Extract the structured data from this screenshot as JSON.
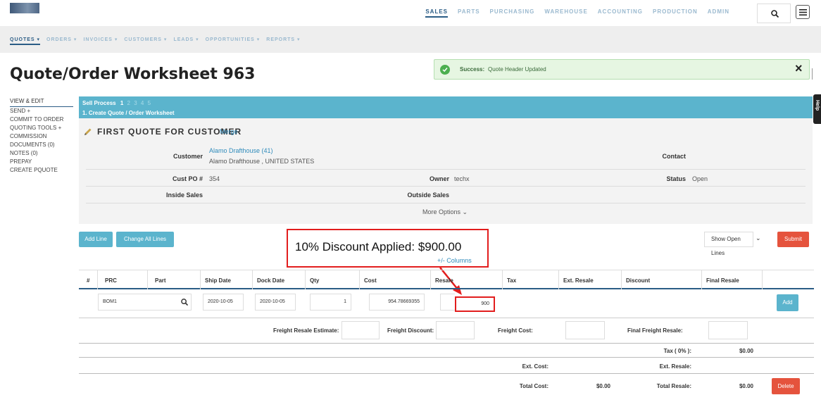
{
  "topnav": {
    "items": [
      "SALES",
      "PARTS",
      "PURCHASING",
      "WAREHOUSE",
      "ACCOUNTING",
      "PRODUCTION",
      "ADMIN"
    ],
    "active": "SALES"
  },
  "subnav": {
    "items": [
      "QUOTES ▾",
      "ORDERS ▾",
      "INVOICES ▾",
      "CUSTOMERS ▾",
      "LEADS ▾",
      "OPPORTUNITIES ▾",
      "REPORTS ▾"
    ]
  },
  "page": {
    "title": "Quote/Order Worksheet 963"
  },
  "alert": {
    "strong": "Success:",
    "message": "Quote Header Updated",
    "close": "×"
  },
  "sidebar": {
    "items": [
      "VIEW & EDIT",
      "SEND +",
      "COMMIT TO ORDER",
      "QUOTING TOOLS +",
      "COMMISSION",
      "DOCUMENTS (0)",
      "NOTES (0)",
      "PREPAY",
      "CREATE PQUOTE"
    ]
  },
  "sell_process": {
    "label": "Sell Process",
    "steps": [
      "1",
      "2",
      "3",
      "4",
      "5"
    ],
    "current": "1. Create Quote / Order Worksheet"
  },
  "help_tab": "Help",
  "header": {
    "quote_name": "FIRST QUOTE FOR CUSTOMER",
    "merge": "Merge",
    "customer_label": "Customer",
    "customer_link": "Alamo Drafthouse (41)",
    "customer_sub": "Alamo Drafthouse , UNITED STATES",
    "contact_label": "Contact",
    "custpo_label": "Cust PO #",
    "custpo_value": "354",
    "owner_label": "Owner",
    "owner_value": "techx",
    "status_label": "Status",
    "status_value": "Open",
    "inside_label": "Inside Sales",
    "outside_label": "Outside Sales",
    "more_options": "More Options ⌄"
  },
  "actions": {
    "add_line": "Add Line",
    "change_all": "Change All Lines",
    "show_lines": "Show Open Lines",
    "submit": "Submit",
    "columns": "+/- Columns"
  },
  "annotation": {
    "text": "10% Discount Applied: $900.00"
  },
  "table": {
    "headers": [
      "#",
      "PRC",
      "Part",
      "Ship Date",
      "Dock Date",
      "Qty",
      "Cost",
      "Resale",
      "Tax",
      "Ext. Resale",
      "Discount",
      "Final Resale"
    ],
    "row": {
      "part": "BOM1",
      "ship_date": "2020-10-05",
      "dock_date": "2020-10-05",
      "qty": "1",
      "cost": "954.78669355",
      "resale": "900",
      "add": "Add"
    }
  },
  "summary": {
    "freight_resale_estimate": "Freight Resale Estimate:",
    "freight_discount": "Freight Discount:",
    "freight_cost": "Freight Cost:",
    "final_freight_resale": "Final Freight Resale:",
    "tax_label": "Tax ( 0% ):",
    "tax_value": "$0.00",
    "ext_cost_label": "Ext. Cost:",
    "ext_resale_label": "Ext. Resale:",
    "total_cost_label": "Total Cost:",
    "total_cost_value": "$0.00",
    "total_resale_label": "Total Resale:",
    "total_resale_value": "$0.00",
    "delete": "Delete"
  },
  "colors": {
    "accent": "#5bb4cd",
    "nav_active": "#2b5d86",
    "danger": "#e5533d",
    "success_bg": "#e6f6e2"
  }
}
